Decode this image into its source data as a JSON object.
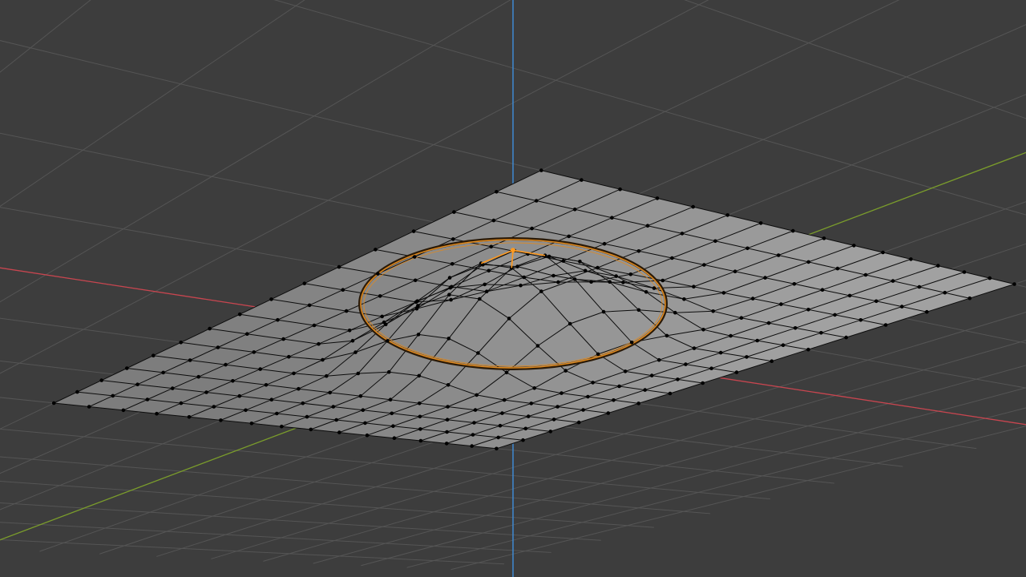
{
  "viewport": {
    "mode": "edit-mode",
    "view": "perspective",
    "background_color": "#3d3d3d",
    "grid_color": "#555555",
    "axis_colors": {
      "x": "#c8454f",
      "y": "#7a9c2b",
      "z": "#3f85c9"
    },
    "mesh": {
      "type": "subdivided-plane",
      "subdivisions": 15,
      "face_color": "#8f8f8f",
      "edge_color": "#0c0c0c",
      "vertex_color": "#000000",
      "selected_color": "#ff9a1f"
    },
    "proportional_edit_circle": {
      "color": "#e08a1f",
      "visible": true
    },
    "gizmo_icons": [
      "vertex-icon",
      "edge-icon",
      "proportional-falloff-icon"
    ]
  }
}
